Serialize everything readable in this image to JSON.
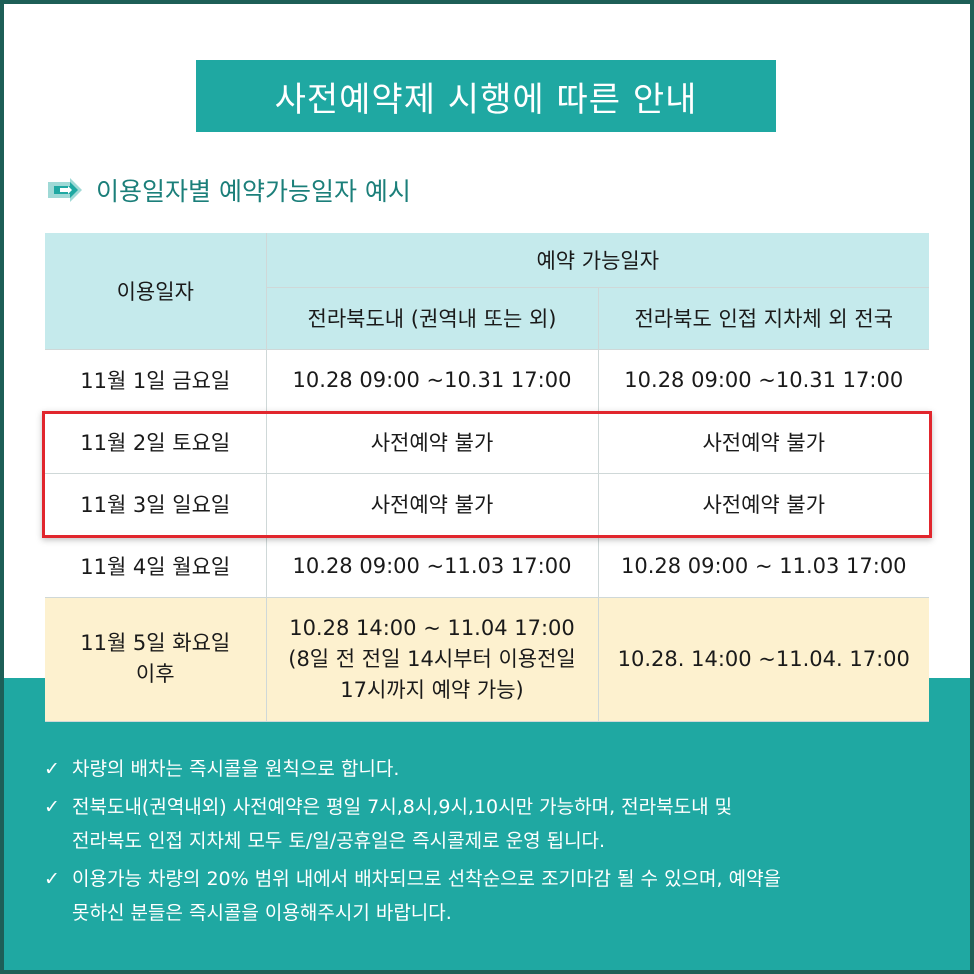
{
  "title": "사전예약제 시행에 따른 안내",
  "subtitle": "이용일자별 예약가능일자 예시",
  "colors": {
    "teal": "#1fa8a2",
    "header_bg": "#c5eaec",
    "highlight_row_bg": "#fdf1cf",
    "red_outline": "#e1262d",
    "frame": "#1d5f57"
  },
  "table": {
    "header": {
      "use_date": "이용일자",
      "reservable_dates": "예약 가능일자",
      "col_jeonbuk": "전라북도내 (권역내 또는 외)",
      "col_nationwide": "전라북도 인접 지차체 외 전국"
    },
    "rows": [
      {
        "date": "11월 1일 금요일",
        "jeonbuk": "10.28  09:00 ~10.31 17:00",
        "nationwide": "10.28  09:00 ~10.31 17:00"
      },
      {
        "date": "11월 2일 토요일",
        "jeonbuk": "사전예약 불가",
        "nationwide": "사전예약 불가"
      },
      {
        "date": "11월 3일 일요일",
        "jeonbuk": "사전예약 불가",
        "nationwide": "사전예약 불가"
      },
      {
        "date": "11월 4일 월요일",
        "jeonbuk": "10.28  09:00 ~11.03  17:00",
        "nationwide": "10.28  09:00 ~ 11.03 17:00"
      },
      {
        "date_line1": "11월 5일 화요일",
        "date_line2": "이후",
        "jeonbuk_line1": "10.28  14:00 ~ 11.04 17:00",
        "jeonbuk_line2": "(8일 전 전일 14시부터 이용전일",
        "jeonbuk_line3": "17시까지 예약 가능)",
        "nationwide": "10.28. 14:00 ~11.04. 17:00"
      }
    ]
  },
  "notes": [
    {
      "check": "✓",
      "line1": "차량의 배차는 즉시콜을 원칙으로 합니다.",
      "line2": ""
    },
    {
      "check": "✓",
      "line1": "전북도내(권역내외) 사전예약은 평일 7시,8시,9시,10시만 가능하며, 전라북도내 및",
      "line2": "전라북도 인접 지차체 모두 토/일/공휴일은 즉시콜제로 운영 됩니다."
    },
    {
      "check": "✓",
      "line1": "이용가능 차량의 20% 범위 내에서 배차되므로 선착순으로 조기마감 될 수 있으며, 예약을",
      "line2": "못하신 분들은 즉시콜을 이용해주시기 바랍니다."
    }
  ]
}
